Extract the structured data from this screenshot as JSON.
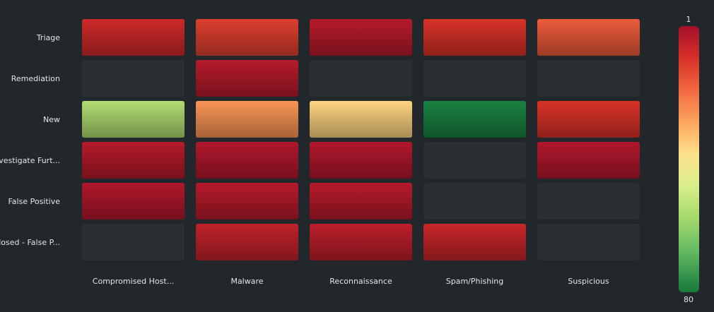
{
  "chart_data": {
    "type": "heatmap",
    "title": "",
    "xlabel": "",
    "ylabel": "",
    "rows": [
      "Triage",
      "Remediation",
      "New",
      "Investigate Furt...",
      "False Positive",
      "losed - False P..."
    ],
    "columns": [
      "Compromised Host...",
      "Malware",
      "Reconnaissance",
      "Spam/Phishing",
      "Suspicious"
    ],
    "values": [
      [
        8,
        12,
        4,
        10,
        16
      ],
      [
        null,
        4,
        null,
        null,
        null
      ],
      [
        52,
        24,
        34,
        78,
        10
      ],
      [
        4,
        3,
        3,
        null,
        3
      ],
      [
        3,
        4,
        4,
        null,
        null
      ],
      [
        null,
        6,
        5,
        7,
        null
      ]
    ],
    "colorbar": {
      "min_label": "1",
      "max_label": "80",
      "min": 1,
      "max": 80
    },
    "colors": {
      "background": "#22272b",
      "empty_cell": "#2a2f33",
      "scale": [
        "#a50f2d",
        "#d73027",
        "#f46d43",
        "#fdae61",
        "#fee08b",
        "#d9ef8b",
        "#a6d96a",
        "#66bd63",
        "#1a9850",
        "#177a3c"
      ]
    }
  }
}
